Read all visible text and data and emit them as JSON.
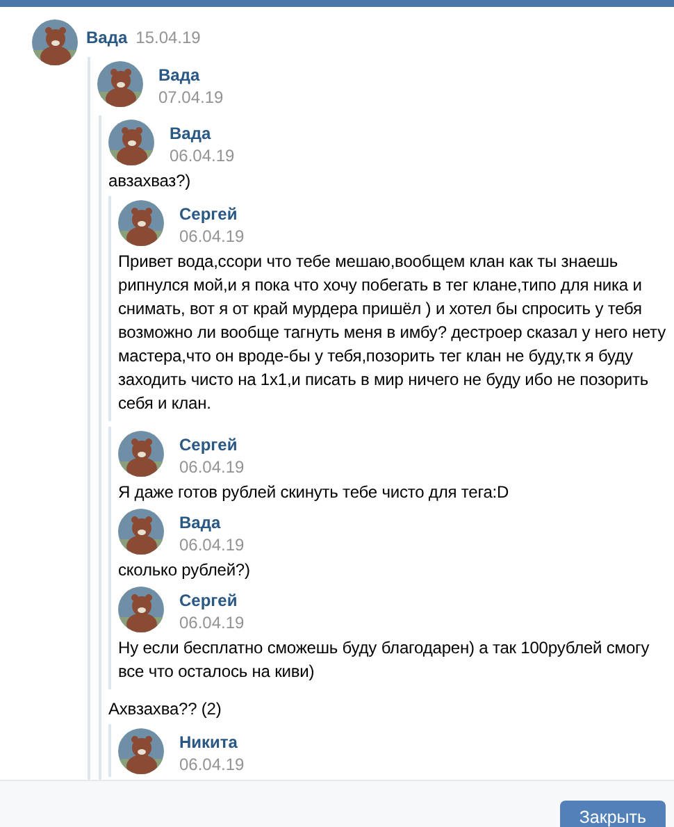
{
  "thread": [
    {
      "kind": "root_post",
      "author": "Вада",
      "date": "15.04.19"
    },
    {
      "kind": "quote",
      "items": [
        {
          "kind": "post",
          "author": "Вада",
          "date": "07.04.19"
        },
        {
          "kind": "quote",
          "items": [
            {
              "kind": "post",
              "author": "Вада",
              "date": "06.04.19",
              "text": "авзахваз?)"
            },
            {
              "kind": "quote",
              "items": [
                {
                  "kind": "post",
                  "author": "Сергей",
                  "date": "06.04.19",
                  "text": "Привет вода,ссори что тебе мешаю,вообщем клан как ты знаешь рипнулся мой,и я пока что хочу побегать в тег клане,типо для ника и снимать, вот я от край мурдера пришёл ) и хотел бы спросить у тебя возможно ли вообще тагнуть меня в имбу? дестроер сказал у него нету мастера,что он вроде-бы у тебя,позорить тег клан не буду,тк я буду заходить чисто на 1х1,и писать в мир ничего не буду ибо не позорить себя и клан."
                }
              ]
            },
            {
              "kind": "quote",
              "items": [
                {
                  "kind": "post",
                  "author": "Сергей",
                  "date": "06.04.19",
                  "text": "Я даже готов рублей скинуть тебе чисто для тега:D"
                },
                {
                  "kind": "post",
                  "author": "Вада",
                  "date": "06.04.19",
                  "text": "сколько рублей?)"
                },
                {
                  "kind": "post",
                  "author": "Сергей",
                  "date": "06.04.19",
                  "text": "Ну если бесплатно сможешь буду благодарен) а так 100рублей смогу все что осталось на киви)"
                }
              ]
            },
            {
              "kind": "text",
              "text": "Ахвзахва?? (2)"
            },
            {
              "kind": "quote",
              "items": [
                {
                  "kind": "post",
                  "author": "Никита",
                  "date": "06.04.19"
                }
              ]
            }
          ]
        }
      ]
    }
  ],
  "close_button": "Закрыть"
}
